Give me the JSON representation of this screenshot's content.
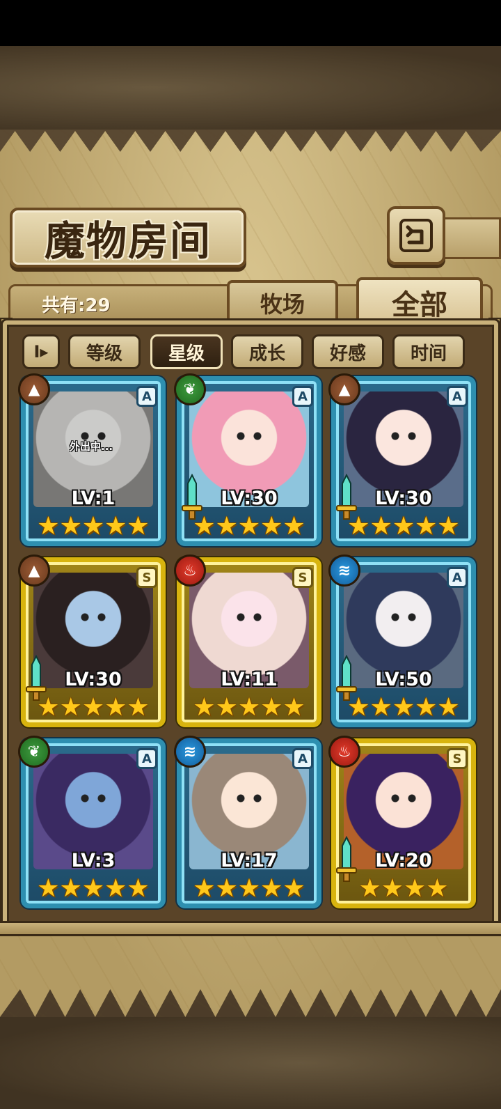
{
  "header": {
    "title": "魔物房间"
  },
  "summary": {
    "total_label": "共有:29"
  },
  "tabs": [
    {
      "label": "牧场",
      "active": false
    },
    {
      "label": "全部",
      "active": true
    }
  ],
  "sort": {
    "toggle_label": "I▸",
    "options": [
      {
        "label": "等级",
        "active": false
      },
      {
        "label": "星级",
        "active": true
      },
      {
        "label": "成长",
        "active": false
      },
      {
        "label": "好感",
        "active": false
      },
      {
        "label": "时间",
        "active": false
      }
    ]
  },
  "monsters": [
    {
      "level": "LV:1",
      "rank": "A",
      "element": "earth-icon",
      "stars": 5,
      "status": "外出中...",
      "weapon": false,
      "frame": "blue"
    },
    {
      "level": "LV:30",
      "rank": "A",
      "element": "nature-icon",
      "stars": 5,
      "status": "",
      "weapon": true,
      "frame": "blue"
    },
    {
      "level": "LV:30",
      "rank": "A",
      "element": "earth-icon",
      "stars": 5,
      "status": "",
      "weapon": true,
      "frame": "blue"
    },
    {
      "level": "LV:30",
      "rank": "S",
      "element": "earth-icon",
      "stars": 5,
      "status": "",
      "weapon": true,
      "frame": "gold"
    },
    {
      "level": "LV:11",
      "rank": "S",
      "element": "fire-icon",
      "stars": 5,
      "status": "",
      "weapon": false,
      "frame": "gold"
    },
    {
      "level": "LV:50",
      "rank": "A",
      "element": "water-icon",
      "stars": 5,
      "status": "",
      "weapon": true,
      "frame": "blue"
    },
    {
      "level": "LV:3",
      "rank": "A",
      "element": "nature-icon",
      "stars": 5,
      "status": "",
      "weapon": false,
      "frame": "blue"
    },
    {
      "level": "LV:17",
      "rank": "A",
      "element": "water-icon",
      "stars": 5,
      "status": "",
      "weapon": false,
      "frame": "blue"
    },
    {
      "level": "LV:20",
      "rank": "S",
      "element": "fire-icon",
      "stars": 4,
      "status": "",
      "weapon": true,
      "frame": "gold"
    }
  ],
  "colors": {
    "blue_frame": "#2e8fb0",
    "gold_frame": "#d8b40e",
    "star": "#ffc81a",
    "earth": "#9a5a34",
    "nature": "#3e9b3e",
    "fire": "#e23a2a",
    "water": "#2a9ae0"
  }
}
